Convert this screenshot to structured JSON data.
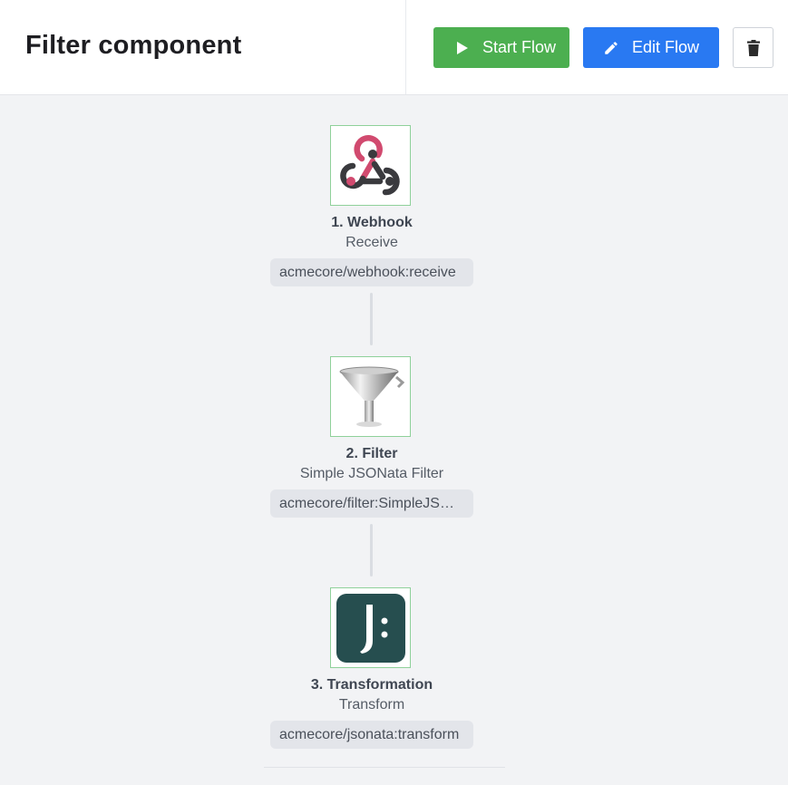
{
  "header": {
    "title": "Filter component",
    "start_button": "Start Flow",
    "edit_button": "Edit Flow",
    "delete_icon": "trash-icon"
  },
  "colors": {
    "start": "#4caf50",
    "edit": "#2979f2",
    "node_border": "#8fd19a",
    "background": "#f2f3f5"
  },
  "steps": [
    {
      "title": "1. Webhook",
      "subtitle": "Receive",
      "component": "acmecore/webhook:receive",
      "icon": "webhook-icon"
    },
    {
      "title": "2. Filter",
      "subtitle": "Simple JSONata Filter",
      "component": "acmecore/filter:SimpleJSONataFilter",
      "icon": "funnel-icon"
    },
    {
      "title": "3. Transformation",
      "subtitle": "Transform",
      "component": "acmecore/jsonata:transform",
      "icon": "jsonata-icon"
    }
  ]
}
